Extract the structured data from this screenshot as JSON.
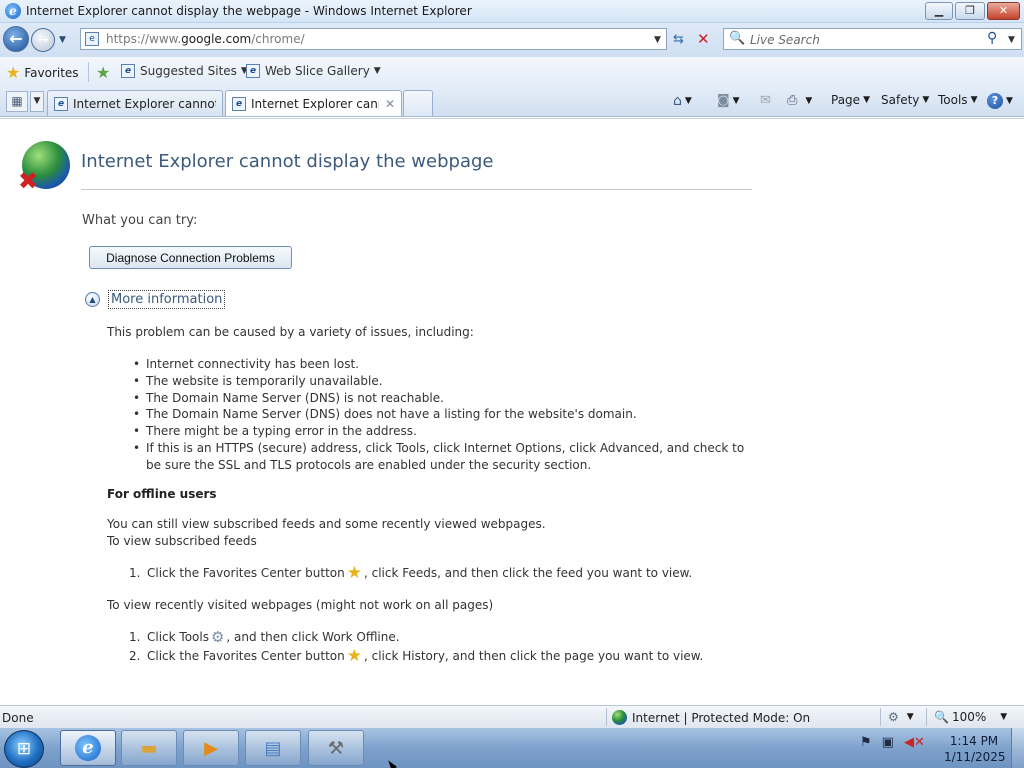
{
  "window": {
    "title": "Internet Explorer cannot display the webpage - Windows Internet Explorer",
    "minimize": "▁",
    "maximize": "❐",
    "close": "✕"
  },
  "address": {
    "url_prefix": "https://www.",
    "url_domain": "google.com",
    "url_path": "/chrome/",
    "search_placeholder": "Live Search"
  },
  "favorites_bar": {
    "favorites_label": "Favorites",
    "items": [
      "Suggested Sites",
      "Web Slice Gallery"
    ]
  },
  "tabs": {
    "items": [
      {
        "label": "Internet Explorer cannot di...",
        "active": false
      },
      {
        "label": "Internet Explorer canno...",
        "active": true
      }
    ]
  },
  "command_bar": {
    "page": "Page",
    "safety": "Safety",
    "tools": "Tools",
    "help": "?"
  },
  "content": {
    "heading": "Internet Explorer cannot display the webpage",
    "try_label": "What you can try:",
    "diagnose_button": "Diagnose Connection Problems",
    "more_info_link": "More information",
    "problem_intro": "This problem can be caused by a variety of issues, including:",
    "causes": [
      "Internet connectivity has been lost.",
      "The website is temporarily unavailable.",
      "The Domain Name Server (DNS) is not reachable.",
      "The Domain Name Server (DNS) does not have a listing for the website's domain.",
      "There might be a typing error in the address.",
      "If this is an HTTPS (secure) address, click Tools, click Internet Options, click Advanced, and check to be sure the SSL and TLS protocols are enabled under the security section."
    ],
    "offline_heading": "For offline users",
    "offline_line1": "You can still view subscribed feeds and some recently viewed webpages.",
    "offline_line2": "To view subscribed feeds",
    "feeds_step": {
      "num": "1.",
      "before": "Click the Favorites Center button",
      "after": ", click Feeds, and then click the feed you want to view."
    },
    "recent_intro": "To view recently visited webpages (might not work on all pages)",
    "recent_steps": [
      {
        "num": "1.",
        "before": "Click Tools",
        "icon": "gear-icon",
        "after": ", and then click Work Offline."
      },
      {
        "num": "2.",
        "before": "Click the Favorites Center button",
        "icon": "star-icon",
        "after": ", click History, and then click the page you want to view."
      }
    ]
  },
  "status": {
    "text": "Done",
    "zone": "Internet | Protected Mode: On",
    "zoom": "100%"
  },
  "taskbar": {
    "time": "1:14 PM",
    "date": "1/11/2025"
  },
  "colors": {
    "heading": "#3c5a7c",
    "link": "#3c5a7c",
    "taskbar": "#7ea2cc"
  }
}
